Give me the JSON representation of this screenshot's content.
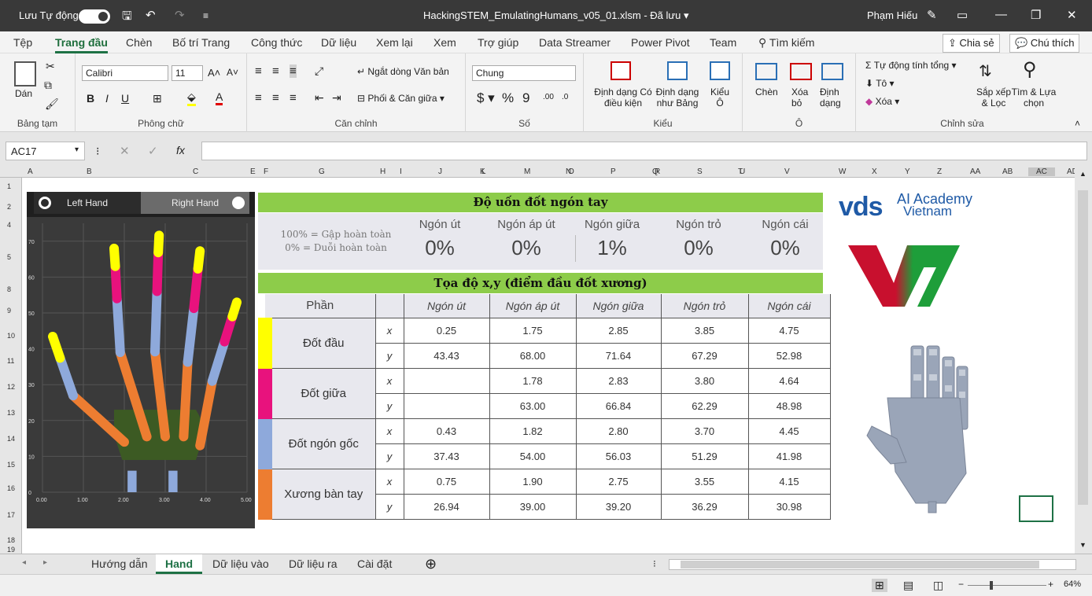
{
  "titlebar": {
    "autosave_label": "Lưu Tự động",
    "filename": "HackingSTEM_EmulatingHumans_v05_01.xlsm",
    "saved_status": "Đã lưu",
    "user": "Phạm Hiếu"
  },
  "menu": {
    "items": [
      "Tệp",
      "Trang đầu",
      "Chèn",
      "Bố trí Trang",
      "Công thức",
      "Dữ liệu",
      "Xem lại",
      "Xem",
      "Trợ giúp",
      "Data Streamer",
      "Power Pivot",
      "Team"
    ],
    "search": "Tìm kiếm",
    "share": "Chia sẻ",
    "comments": "Chú thích"
  },
  "ribbon": {
    "clipboard": {
      "paste": "Dán",
      "label": "Bảng tạm"
    },
    "font": {
      "name": "Calibri",
      "size": "11",
      "label": "Phông chữ",
      "bold": "B",
      "italic": "I",
      "underline": "U"
    },
    "alignment": {
      "wrap": "Ngắt dòng Văn bản",
      "merge": "Phối & Căn giữa",
      "label": "Căn chỉnh"
    },
    "number": {
      "format": "Chung",
      "label": "Số"
    },
    "styles": {
      "conditional": "Định dạng Có điều kiện",
      "table": "Định dạng như Bảng",
      "cell": "Kiểu Ô",
      "label": "Kiểu"
    },
    "cells": {
      "insert": "Chèn",
      "delete": "Xóa bỏ",
      "format": "Định dạng",
      "label": "Ô"
    },
    "editing": {
      "autosum": "Tự động tính tổng",
      "fill": "Tô",
      "clear": "Xóa",
      "sort": "Sắp xếp & Lọc",
      "find": "Tìm & Lựa chọn",
      "label": "Chỉnh sửa"
    }
  },
  "formula": {
    "namebox": "AC17",
    "fx": "fx",
    "value": ""
  },
  "columns": [
    "A",
    "B",
    "C",
    "E",
    "F",
    "G",
    "H",
    "I",
    "J",
    "K",
    "L",
    "M",
    "N",
    "O",
    "P",
    "Q",
    "R",
    "S",
    "T",
    "U",
    "V",
    "W",
    "X",
    "Y",
    "Z",
    "AA",
    "AB",
    "AC",
    "AD"
  ],
  "rows": [
    "1",
    "2",
    "4",
    "5",
    "8",
    "9",
    "10",
    "11",
    "12",
    "13",
    "14",
    "15",
    "16",
    "17",
    "18",
    "19"
  ],
  "hand_panel": {
    "left": "Left Hand",
    "right": "Right Hand",
    "y_ticks": [
      "0",
      "10",
      "20",
      "30",
      "40",
      "50",
      "60",
      "70"
    ],
    "x_ticks": [
      "0.00",
      "1.00",
      "2.00",
      "3.00",
      "4.00",
      "5.00"
    ]
  },
  "bend": {
    "title": "Độ uốn đốt ngón tay",
    "legend1": "100% = Gập hoàn toàn",
    "legend2": "0% = Duỗi hoàn toàn",
    "fingers": [
      {
        "name": "Ngón út",
        "value": "0%"
      },
      {
        "name": "Ngón áp út",
        "value": "0%"
      },
      {
        "name": "Ngón giữa",
        "value": "1%"
      },
      {
        "name": "Ngón trỏ",
        "value": "0%"
      },
      {
        "name": "Ngón cái",
        "value": "0%"
      }
    ]
  },
  "coords": {
    "title": "Tọa độ x,y (điểm đầu đốt xương)",
    "part_header": "Phần",
    "finger_headers": [
      "Ngón út",
      "Ngón áp út",
      "Ngón giữa",
      "Ngón trỏ",
      "Ngón cái"
    ],
    "rows": [
      {
        "part": "Đốt đầu",
        "color": "#ffff00",
        "x": [
          "0.25",
          "1.75",
          "2.85",
          "3.85",
          "4.75"
        ],
        "y": [
          "43.43",
          "68.00",
          "71.64",
          "67.29",
          "52.98"
        ]
      },
      {
        "part": "Đốt giữa",
        "color": "#e8127d",
        "x": [
          "",
          "1.78",
          "2.83",
          "3.80",
          "4.64"
        ],
        "y": [
          "",
          "63.00",
          "66.84",
          "62.29",
          "48.98"
        ]
      },
      {
        "part": "Đốt ngón gốc",
        "color": "#8ea9db",
        "x": [
          "0.43",
          "1.82",
          "2.80",
          "3.70",
          "4.45"
        ],
        "y": [
          "37.43",
          "54.00",
          "56.03",
          "51.29",
          "41.98"
        ]
      },
      {
        "part": "Xương bàn tay",
        "color": "#ed7d31",
        "x": [
          "0.75",
          "1.90",
          "2.75",
          "3.55",
          "4.15"
        ],
        "y": [
          "26.94",
          "39.00",
          "39.20",
          "36.29",
          "30.98"
        ]
      }
    ]
  },
  "logo": {
    "brand": "vds",
    "line1": "AI Academy",
    "line2": "Vietnam"
  },
  "tabs": [
    "Hướng dẫn",
    "Hand",
    "Dữ liệu vào",
    "Dữ liệu ra",
    "Cài đặt"
  ],
  "active_tab": "Hand",
  "zoom": "64%"
}
